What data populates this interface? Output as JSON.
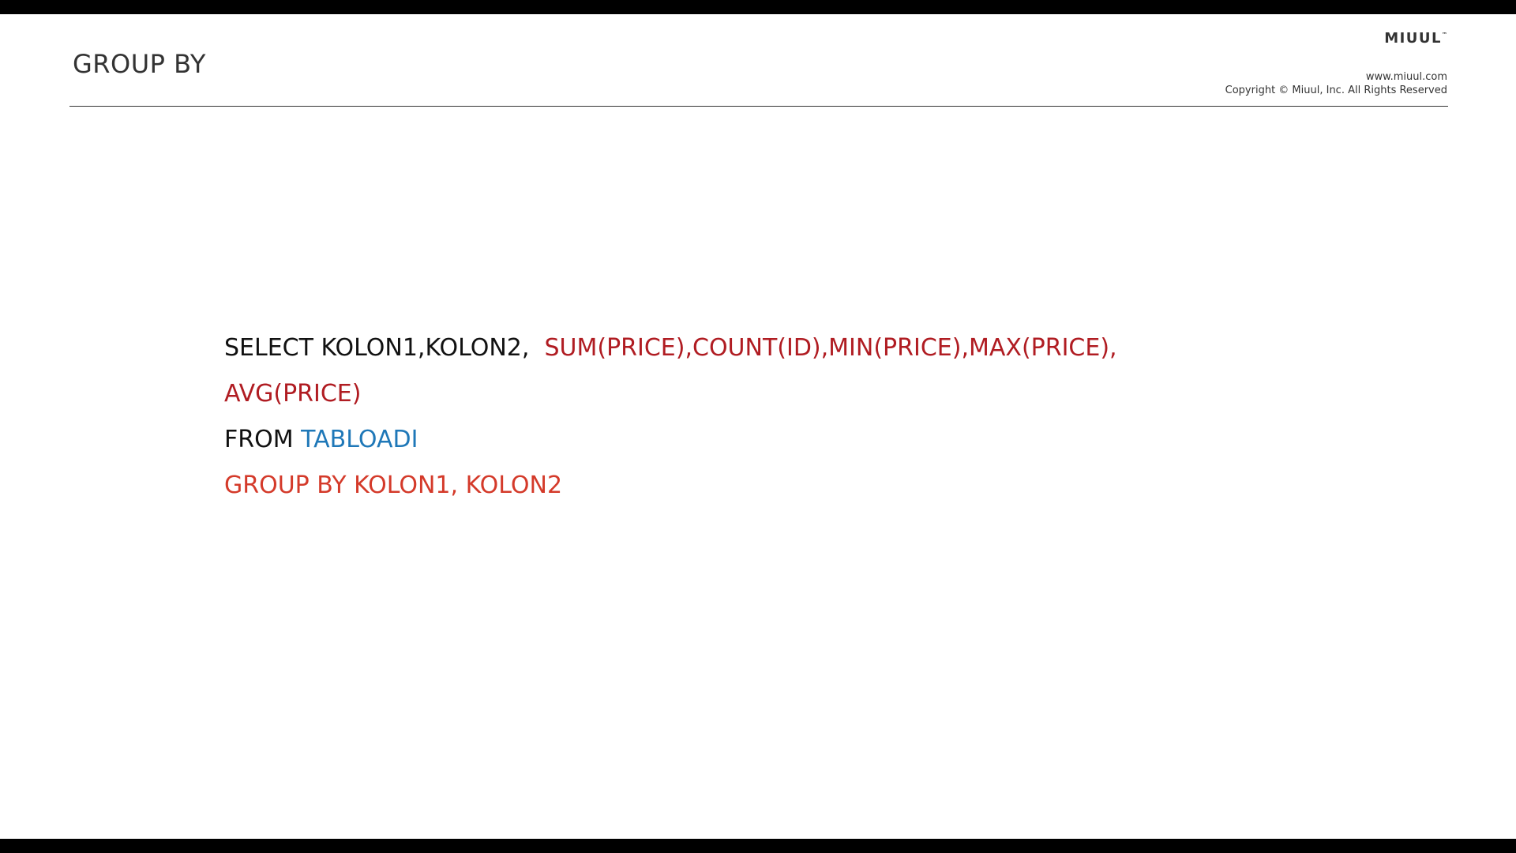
{
  "slide": {
    "title": "GROUP BY",
    "brand": "MIUUL",
    "brand_mark": "™",
    "website": "www.miuul.com",
    "copyright": "Copyright © Miuul, Inc. All Rights Reserved"
  },
  "code": {
    "select_keyword": "SELECT KOLON1,KOLON2,  ",
    "aggregates_line1": "SUM(PRICE),COUNT(ID),MIN(PRICE),MAX(PRICE),",
    "aggregates_line2": "AVG(PRICE)",
    "from_keyword": "FROM ",
    "table_name": "TABLOADI",
    "group_by_clause": "GROUP BY KOLON1, KOLON2"
  },
  "colors": {
    "frame": "#000000",
    "slide_background": "#ffffff",
    "text": "#111111",
    "aggregates": "#b01c22",
    "table_name": "#1f78b8",
    "group_by": "#d43a2a"
  }
}
